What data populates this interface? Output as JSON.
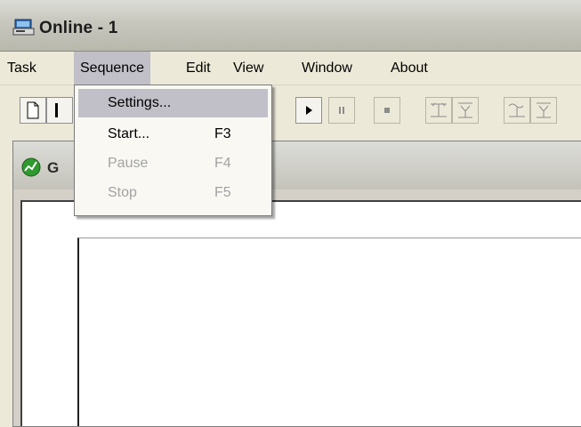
{
  "window": {
    "title": "Online - 1"
  },
  "menubar": {
    "items": [
      {
        "label": "Task"
      },
      {
        "label": "Sequence",
        "active": true
      },
      {
        "label": "Edit"
      },
      {
        "label": "View"
      },
      {
        "label": "Window"
      },
      {
        "label": "About"
      }
    ]
  },
  "sequence_menu": {
    "items": [
      {
        "label": "Settings...",
        "shortcut": ""
      },
      {
        "label": "Start...",
        "shortcut": "F3"
      },
      {
        "label": "Pause",
        "shortcut": "F4",
        "disabled": true
      },
      {
        "label": "Stop",
        "shortcut": "F5",
        "disabled": true
      }
    ]
  },
  "child_window": {
    "title": "G"
  },
  "toolbar": {
    "icons": [
      "new-icon",
      "open-icon",
      "play-icon",
      "pause-icon",
      "stop-icon",
      "zoom-x-icon",
      "zoom-y-icon",
      "zoom-x-alt-icon",
      "zoom-y-alt-icon"
    ]
  },
  "colors": {
    "menu_highlight": "#c1c0c8",
    "disabled_text": "#a3a3a3",
    "face": "#ece9d8"
  }
}
